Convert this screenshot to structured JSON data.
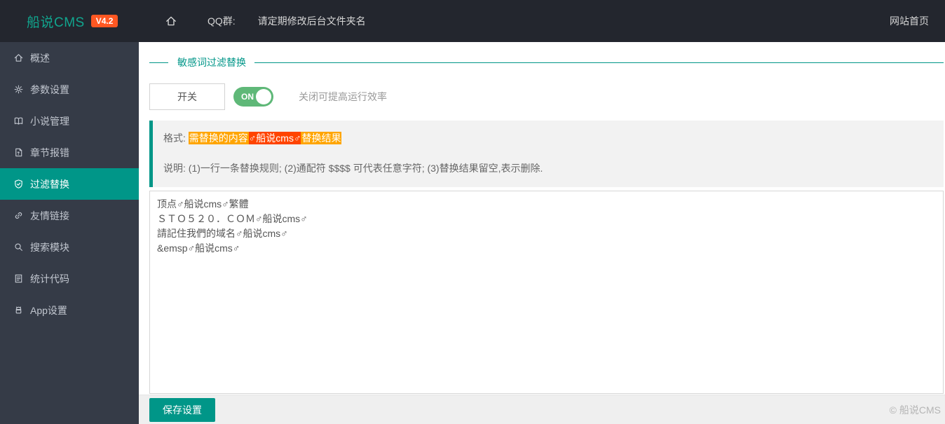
{
  "header": {
    "logo_text": "船说CMS",
    "version_badge": "V4.2",
    "qq_label": "QQ群:",
    "notice": "请定期修改后台文件夹名",
    "home_link": "网站首页"
  },
  "sidebar": {
    "items": [
      {
        "label": "概述",
        "icon": "home-icon",
        "active": false
      },
      {
        "label": "参数设置",
        "icon": "gear-icon",
        "active": false
      },
      {
        "label": "小说管理",
        "icon": "book-icon",
        "active": false
      },
      {
        "label": "章节报错",
        "icon": "report-icon",
        "active": false
      },
      {
        "label": "过滤替换",
        "icon": "shield-check-icon",
        "active": true
      },
      {
        "label": "友情链接",
        "icon": "link-icon",
        "active": false
      },
      {
        "label": "搜索模块",
        "icon": "search-icon",
        "active": false
      },
      {
        "label": "统计代码",
        "icon": "document-icon",
        "active": false
      },
      {
        "label": "App设置",
        "icon": "android-icon",
        "active": false
      }
    ]
  },
  "main": {
    "section_title": "敏感词过滤替换",
    "switch": {
      "label": "开关",
      "state": "ON",
      "hint": "关闭可提高运行效率"
    },
    "format": {
      "label": "格式:",
      "source": "需替换的内容",
      "separator": "♂船说cms♂",
      "result": "替换结果"
    },
    "note": "说明: (1)一行一条替换规则; (2)通配符 $$$$ 可代表任意字符; (3)替换结果留空,表示删除.",
    "rules": "顶点♂船说cms♂繁體\nＳＴＯ５２０．ＣＯＭ♂船说cms♂\n請記住我們的域名♂船说cms♂\n&emsp♂船说cms♂",
    "save_button": "保存设置"
  },
  "footer": {
    "copyright": "© 船说CMS"
  },
  "colors": {
    "accent_teal": "#009688",
    "toggle_green": "#5FB878",
    "badge_orange": "#FF5722",
    "highlight_orange": "#FFA500",
    "highlight_red": "#FF4400",
    "header_bg": "#23262E",
    "sidebar_bg": "#353B47"
  }
}
